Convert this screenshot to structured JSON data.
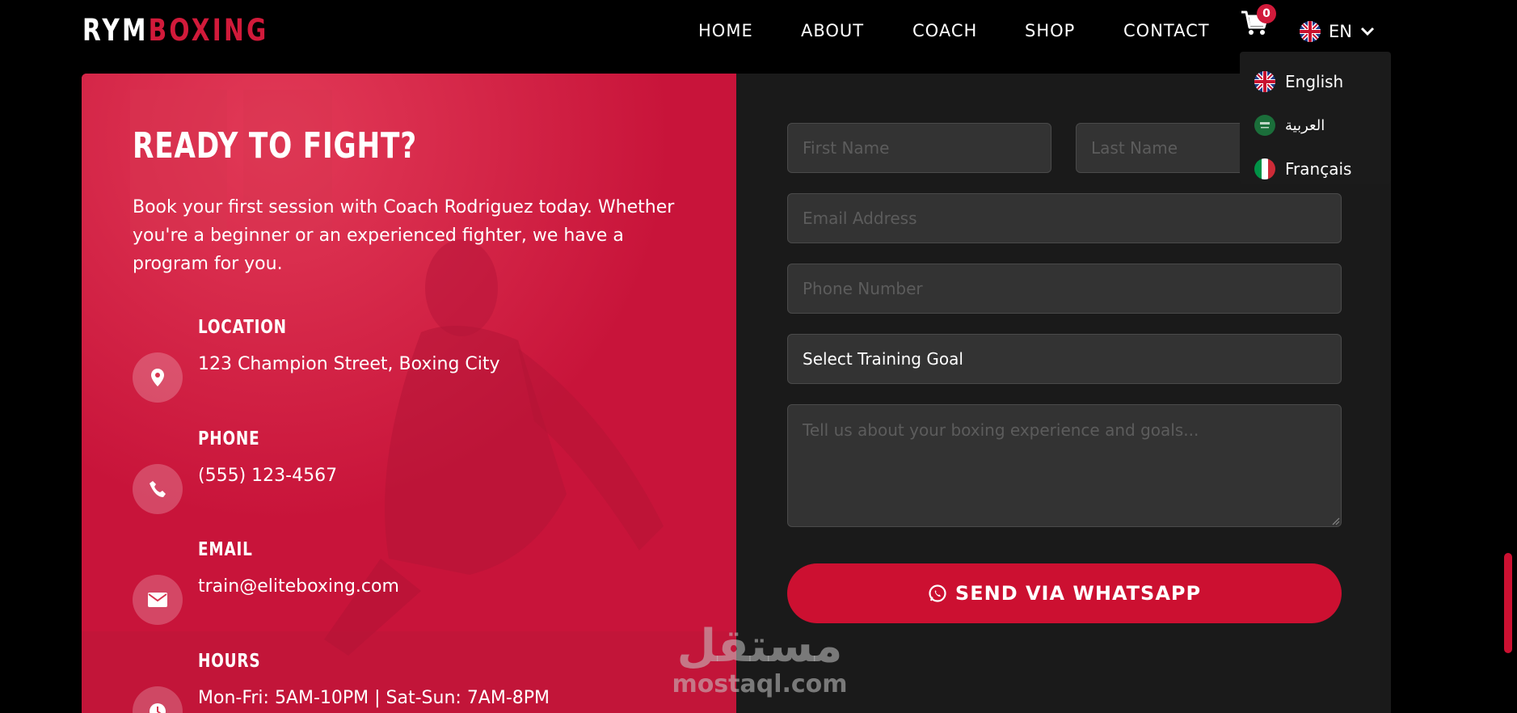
{
  "nav": {
    "logo_white": "RYM",
    "logo_red": "BOXING",
    "items": [
      "HOME",
      "ABOUT",
      "COACH",
      "SHOP",
      "CONTACT"
    ],
    "cart_count": "0",
    "language_code": "EN"
  },
  "language_menu": {
    "options": [
      "English",
      "العربية",
      "Français"
    ]
  },
  "contact": {
    "title": "READY TO FIGHT?",
    "lead": "Book your first session with Coach Rodriguez today. Whether you're a beginner or an experienced fighter, we have a program for you.",
    "location_label": "LOCATION",
    "location_value": "123 Champion Street, Boxing City",
    "phone_label": "PHONE",
    "phone_value": "(555) 123-4567",
    "email_label": "EMAIL",
    "email_value": "train@eliteboxing.com",
    "hours_label": "HOURS",
    "hours_value": "Mon-Fri: 5AM-10PM | Sat-Sun: 7AM-8PM"
  },
  "form": {
    "first_name_placeholder": "First Name",
    "last_name_placeholder": "Last Name",
    "email_placeholder": "Email Address",
    "phone_placeholder": "Phone Number",
    "goal_selected": "Select Training Goal",
    "message_placeholder": "Tell us about your boxing experience and goals...",
    "submit_label": "SEND VIA WHATSAPP"
  },
  "watermark": {
    "arabic": "مستقل",
    "latin": "mostaql.com"
  },
  "colors": {
    "accent": "#cc1031",
    "panel_dark": "#1a1a1a",
    "panel_red": "#c8143a"
  }
}
